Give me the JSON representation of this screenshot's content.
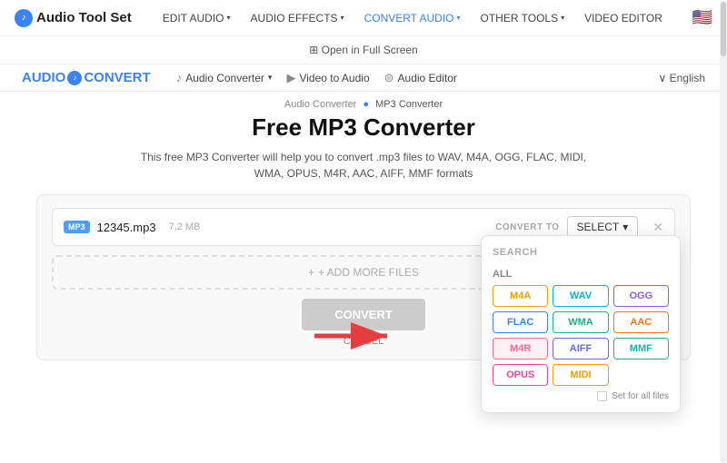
{
  "brand": {
    "name": "Audio Tool Set",
    "icon_letter": "♪"
  },
  "top_nav": {
    "items": [
      {
        "label": "EDIT AUDIO",
        "has_chevron": true,
        "active": false
      },
      {
        "label": "AUDIO EFFECTS",
        "has_chevron": true,
        "active": false
      },
      {
        "label": "CONVERT AUDIO",
        "has_chevron": true,
        "active": true
      },
      {
        "label": "OTHER TOOLS",
        "has_chevron": true,
        "active": false
      },
      {
        "label": "VIDEO EDITOR",
        "has_chevron": false,
        "active": false
      }
    ],
    "flag": "🇺🇸"
  },
  "fullscreen_bar": {
    "label": "⊞ Open in Full Screen"
  },
  "inner_nav": {
    "brand": "AUDIOCONVERT",
    "brand_icon": "♪",
    "items": [
      {
        "icon": "♪",
        "label": "Audio Converter",
        "has_chevron": true
      },
      {
        "icon": "▶",
        "label": "Video to Audio",
        "has_chevron": false
      },
      {
        "icon": "⊜",
        "label": "Audio Editor",
        "has_chevron": false
      }
    ],
    "lang": "∨ English"
  },
  "breadcrumb": {
    "parent": "Audio Converter",
    "current": "MP3 Converter"
  },
  "page": {
    "title": "Free MP3 Converter",
    "description": "This free MP3 Converter will help you to convert .mp3 files to WAV, M4A, OGG, FLAC, MIDI, WMA, OPUS, M4R, AAC, AIFF, MMF formats"
  },
  "converter": {
    "file_name": "12345.mp3",
    "file_size": "7.2 MB",
    "convert_to_label": "CONVERT TO",
    "select_btn": "SELECT",
    "add_more_label": "+ ADD MORE FILES",
    "convert_btn": "CONVERT",
    "cancel_label": "CANCEL"
  },
  "dropdown": {
    "search_label": "SEARCH",
    "all_label": "ALL",
    "formats": [
      {
        "label": "M4A",
        "class": "m4a"
      },
      {
        "label": "WAV",
        "class": "wav"
      },
      {
        "label": "OGG",
        "class": "ogg"
      },
      {
        "label": "FLAC",
        "class": "flac"
      },
      {
        "label": "WMA",
        "class": "wma"
      },
      {
        "label": "AAC",
        "class": "aac"
      },
      {
        "label": "M4R",
        "class": "m4r"
      },
      {
        "label": "AIFF",
        "class": "aiff"
      },
      {
        "label": "MMF",
        "class": "mmf"
      },
      {
        "label": "OPUS",
        "class": "opus"
      },
      {
        "label": "MIDI",
        "class": "midi"
      }
    ],
    "set_for_all_label": "Set for all files"
  }
}
